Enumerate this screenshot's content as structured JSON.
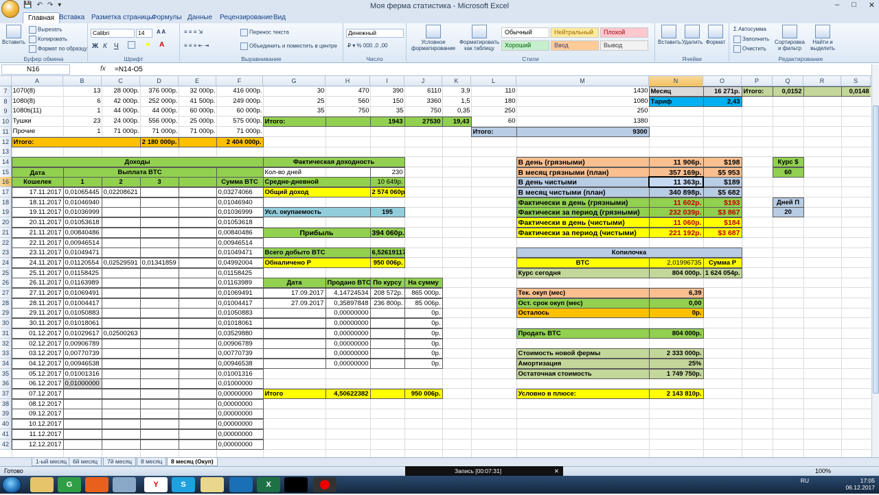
{
  "window": {
    "title": "Моя ферма статистика - Microsoft Excel"
  },
  "tabs": [
    "Главная",
    "Вставка",
    "Разметка страницы",
    "Формулы",
    "Данные",
    "Рецензирование",
    "Вид"
  ],
  "ribbon": {
    "paste": "Вставить",
    "cut": "Вырезать",
    "copy": "Копировать",
    "format_painter": "Формат по образцу",
    "clipboard": "Буфер обмена",
    "font_name": "Calibri",
    "font_size": "14",
    "font_group": "Шрифт",
    "wrap": "Перенос текста",
    "merge": "Объединить и поместить в центре",
    "align_group": "Выравнивание",
    "number_format": "Денежный",
    "number_group": "Число",
    "cond_format": "Условное форматирование",
    "format_table": "Форматировать как таблицу",
    "styles": [
      "Обычный",
      "Нейтральный",
      "Плохой",
      "Хороший",
      "Ввод",
      "Вывод"
    ],
    "styles_group": "Стили",
    "insert": "Вставить",
    "delete": "Удалить",
    "format": "Формат",
    "cells_group": "Ячейки",
    "autosum": "Автосумма",
    "fill": "Заполнить",
    "clear": "Очистить",
    "sort": "Сортировка и фильтр",
    "find": "Найти и выделить",
    "edit_group": "Редактирование"
  },
  "formula_bar": {
    "name_box": "N16",
    "fx": "fx",
    "formula": "=N14-O5"
  },
  "columns": [
    "A",
    "B",
    "C",
    "D",
    "E",
    "F",
    "G",
    "H",
    "I",
    "J",
    "K",
    "L",
    "M",
    "N",
    "O",
    "P",
    "Q",
    "R",
    "S"
  ],
  "rows": [
    "7",
    "8",
    "9",
    "10",
    "11",
    "12",
    "13",
    "14",
    "15",
    "16",
    "17",
    "18",
    "19",
    "20",
    "21",
    "22",
    "23",
    "24",
    "25",
    "26",
    "27",
    "28",
    "29",
    "30",
    "31",
    "32",
    "33",
    "34",
    "35",
    "36",
    "37",
    "38",
    "39",
    "40",
    "41",
    "42"
  ],
  "sheet": {
    "top": [
      [
        "1070(8)",
        "13",
        "28 000р.",
        "376 000р.",
        "32 000р.",
        "416 000р.",
        "30",
        "470",
        "390",
        "6110",
        "3,9",
        "110",
        "1430"
      ],
      [
        "1080(8)",
        "6",
        "42 000р.",
        "252 000р.",
        "41 500р.",
        "249 000р.",
        "25",
        "560",
        "150",
        "3360",
        "1,5",
        "180",
        "1080"
      ],
      [
        "1080ti(11)",
        "1",
        "44 000р.",
        "44 000р.",
        "60 000р.",
        "60 000р.",
        "35",
        "750",
        "35",
        "750",
        "0,35",
        "250",
        "250"
      ],
      [
        "Тушки",
        "23",
        "24 000р.",
        "556 000р.",
        "25 000р.",
        "575 000р.",
        "Итого:",
        "",
        "1943",
        "27530",
        "19,43",
        "60",
        "1380"
      ],
      [
        "Прочие",
        "1",
        "71 000р.",
        "71 000р.",
        "71 000р.",
        "71 000р.",
        "",
        "",
        "",
        "",
        "",
        "Итого:",
        "9300"
      ]
    ],
    "row12": {
      "label": "Итого:",
      "d": "2 180 000р.",
      "f": "2 404 000р."
    },
    "month": {
      "label": "Месяц",
      "value": "16 271р.",
      "total_label": "Итого:",
      "q": "0,0152",
      "s": "0,0148",
      "tariff_label": "Тариф",
      "tariff": "2,43"
    },
    "income": {
      "title": "Доходы",
      "date": "Дата",
      "payout": "Выплата BTC",
      "wallet": "Кошелек",
      "c1": "1",
      "c2": "2",
      "c3": "3",
      "sum": "Сумма BTC",
      "rows": [
        [
          "17.11.2017",
          "0,01065445",
          "0,02208621",
          "",
          "0,03274066"
        ],
        [
          "18.11.2017",
          "0,01046940",
          "",
          "",
          "0,01046940"
        ],
        [
          "19.11.2017",
          "0,01036999",
          "",
          "",
          "0,01036999"
        ],
        [
          "20.11.2017",
          "0,01053618",
          "",
          "",
          "0,01053618"
        ],
        [
          "21.11.2017",
          "0,00840486",
          "",
          "",
          "0,00840486"
        ],
        [
          "22.11.2017",
          "0,00946514",
          "",
          "",
          "0,00946514"
        ],
        [
          "23.11.2017",
          "0,01049471",
          "",
          "",
          "0,01049471"
        ],
        [
          "24.11.2017",
          "0,01120554",
          "0,02529591",
          "0,01341859",
          "0,04992004"
        ],
        [
          "25.11.2017",
          "0,01158425",
          "",
          "",
          "0,01158425"
        ],
        [
          "26.11.2017",
          "0,01163989",
          "",
          "",
          "0,01163989"
        ],
        [
          "27.11.2017",
          "0,01069491",
          "",
          "",
          "0,01069491"
        ],
        [
          "28.11.2017",
          "0,01004417",
          "",
          "",
          "0,01004417"
        ],
        [
          "29.11.2017",
          "0,01050883",
          "",
          "",
          "0,01050883"
        ],
        [
          "30.11.2017",
          "0,01018061",
          "",
          "",
          "0,01018061"
        ],
        [
          "01.12.2017",
          "0,01029617",
          "0,02500263",
          "",
          "0,03529880"
        ],
        [
          "02.12.2017",
          "0,00906789",
          "",
          "",
          "0,00906789"
        ],
        [
          "03.12.2017",
          "0,00770739",
          "",
          "",
          "0,00770739"
        ],
        [
          "04.12.2017",
          "0,00946538",
          "",
          "",
          "0,00946538"
        ],
        [
          "05.12.2017",
          "0,01001316",
          "",
          "",
          "0,01001316"
        ],
        [
          "06.12.2017",
          "0,01000000",
          "",
          "",
          "0,01000000"
        ],
        [
          "07.12.2017",
          "",
          "",
          "",
          "0,00000000"
        ],
        [
          "08.12.2017",
          "",
          "",
          "",
          "0,00000000"
        ],
        [
          "09.12.2017",
          "",
          "",
          "",
          "0,00000000"
        ],
        [
          "10.12.2017",
          "",
          "",
          "",
          "0,00000000"
        ],
        [
          "11.12.2017",
          "",
          "",
          "",
          "0,00000000"
        ],
        [
          "12.12.2017",
          "",
          "",
          "",
          "0,00000000"
        ]
      ]
    },
    "actual": {
      "title": "Фактическая доходность",
      "days_label": "Кол-во дней",
      "days": "230",
      "avg_label": "Средне-дневной",
      "avg": "10 649р.",
      "total_label": "Общий доход",
      "total": "2 574 060р.",
      "payback_label": "Усл. окупаемость",
      "payback": "195",
      "profit_label": "Прибыль",
      "profit": "394 060р.",
      "mined_label": "Всего добыто BTC",
      "mined": "6,52619117",
      "cashed_label": "Обналичено Р",
      "cashed": "950 006р."
    },
    "sales": {
      "h_date": "Дата",
      "h_sold": "Продано BTC",
      "h_rate": "По курсу",
      "h_sum": "На сумму",
      "rows": [
        [
          "17.09.2017",
          "4,14724534",
          "208 572р.",
          "865 000р."
        ],
        [
          "27.09.2017",
          "0,35897848",
          "236 800р.",
          "85 006р."
        ],
        [
          "",
          "0,00000000",
          "",
          "0р."
        ],
        [
          "",
          "0,00000000",
          "",
          "0р."
        ],
        [
          "",
          "0,00000000",
          "",
          "0р."
        ],
        [
          "",
          "0,00000000",
          "",
          "0р."
        ],
        [
          "",
          "0,00000000",
          "",
          "0р."
        ],
        [
          "",
          "0,00000000",
          "",
          "0р."
        ]
      ],
      "total_label": "Итого",
      "total_btc": "4,50622382",
      "total_sum": "950 006р."
    },
    "perday": [
      [
        "В день (грязными)",
        "11 906р.",
        "$198"
      ],
      [
        "В месяц грязными (план)",
        "357 169р.",
        "$5 953"
      ],
      [
        "В день чистыми",
        "11 363р.",
        "$189"
      ],
      [
        "В месяц чистыми (план)",
        "340 898р.",
        "$5 682"
      ],
      [
        "Фактически в день (грязными)",
        "11 602р.",
        "$193"
      ],
      [
        "Фактически за период (грязными)",
        "232 039р.",
        "$3 867"
      ],
      [
        "Фактически в день (чистыми)",
        "11 060р.",
        "$184"
      ],
      [
        "Фактически за период (чистыми)",
        "221 192р.",
        "$3 687"
      ]
    ],
    "rate": {
      "label": "Курс $",
      "value": "60",
      "days_label": "Дней П",
      "days": "20"
    },
    "piggy": {
      "title": "Копилочка",
      "btc_label": "BTC",
      "btc": "2,01996735",
      "sum_label": "Сумма Р",
      "rate_label": "Курс сегодня",
      "rate": "804 000р.",
      "sum": "1 624 054р."
    },
    "payback": [
      [
        "Тек. окуп (мес)",
        "6,39"
      ],
      [
        "Ост. срок окуп (мес)",
        "0,00"
      ],
      [
        "Осталось",
        "0р."
      ]
    ],
    "sell": {
      "label": "Продать BTC",
      "value": "804 000р."
    },
    "farm": [
      [
        "Стоимость новой фермы",
        "2 333 000р."
      ],
      [
        "Амортизация",
        "25%"
      ],
      [
        "Остаточная стоимость",
        "1 749 750р."
      ]
    ],
    "plus": {
      "label": "Условно в плюсе:",
      "value": "2 143 810р."
    }
  },
  "sheet_tabs": [
    "1-ый месяц",
    "6й месяц",
    "7й месяц",
    "8 месяц",
    "8 месяц (Окуп)"
  ],
  "status": {
    "ready": "Готово",
    "record": "Запись [00:07:31]",
    "zoom": "100%"
  },
  "tray": {
    "lang": "RU",
    "time": "17:05",
    "date": "06.12.2017"
  },
  "colors": {
    "green": "#92d050",
    "yellow": "#ffff00",
    "orange": "#ffc000",
    "blue": "#92cddc",
    "salmon": "#fabf8f",
    "lightblue": "#b8cce4",
    "gray": "#d9d9d9",
    "lime": "#c4d79b",
    "cyan": "#00b0f0"
  }
}
